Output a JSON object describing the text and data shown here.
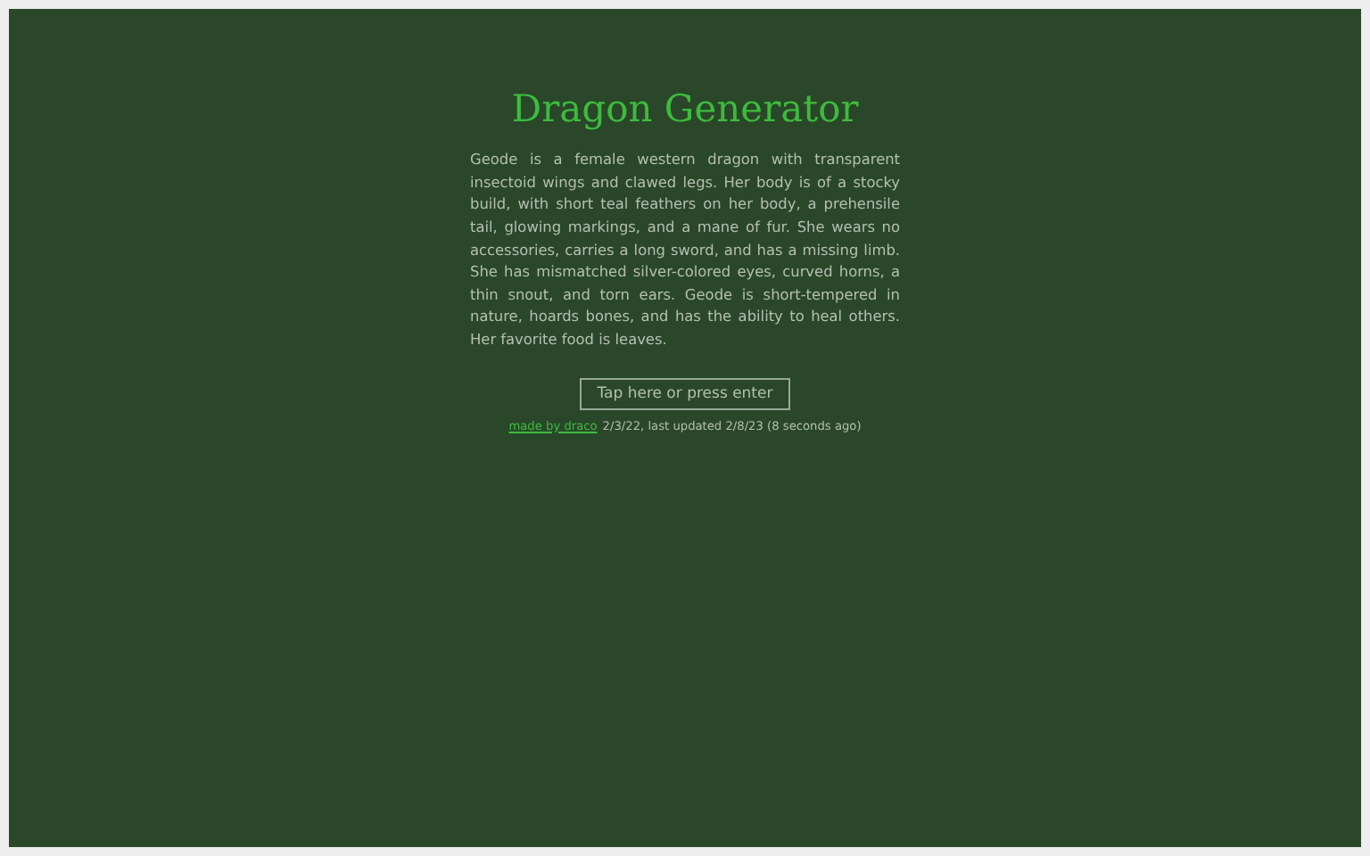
{
  "title": "Dragon Generator",
  "description": "Geode is a female western dragon with transparent insectoid wings and clawed legs. Her body is of a stocky build, with short teal feathers on her body, a prehensile tail, glowing markings, and a mane of fur. She wears no accessories, carries a long sword, and has a missing limb. She has mismatched silver-colored eyes, curved horns, a thin snout, and torn ears. Geode is short-tempered in nature, hoards bones, and has the ability to heal others. Her favorite food is leaves.",
  "button": "Tap here or press enter",
  "credit": {
    "link": "made by draco",
    "text": "2/3/22, last updated 2/8/23 (8 seconds ago)"
  }
}
